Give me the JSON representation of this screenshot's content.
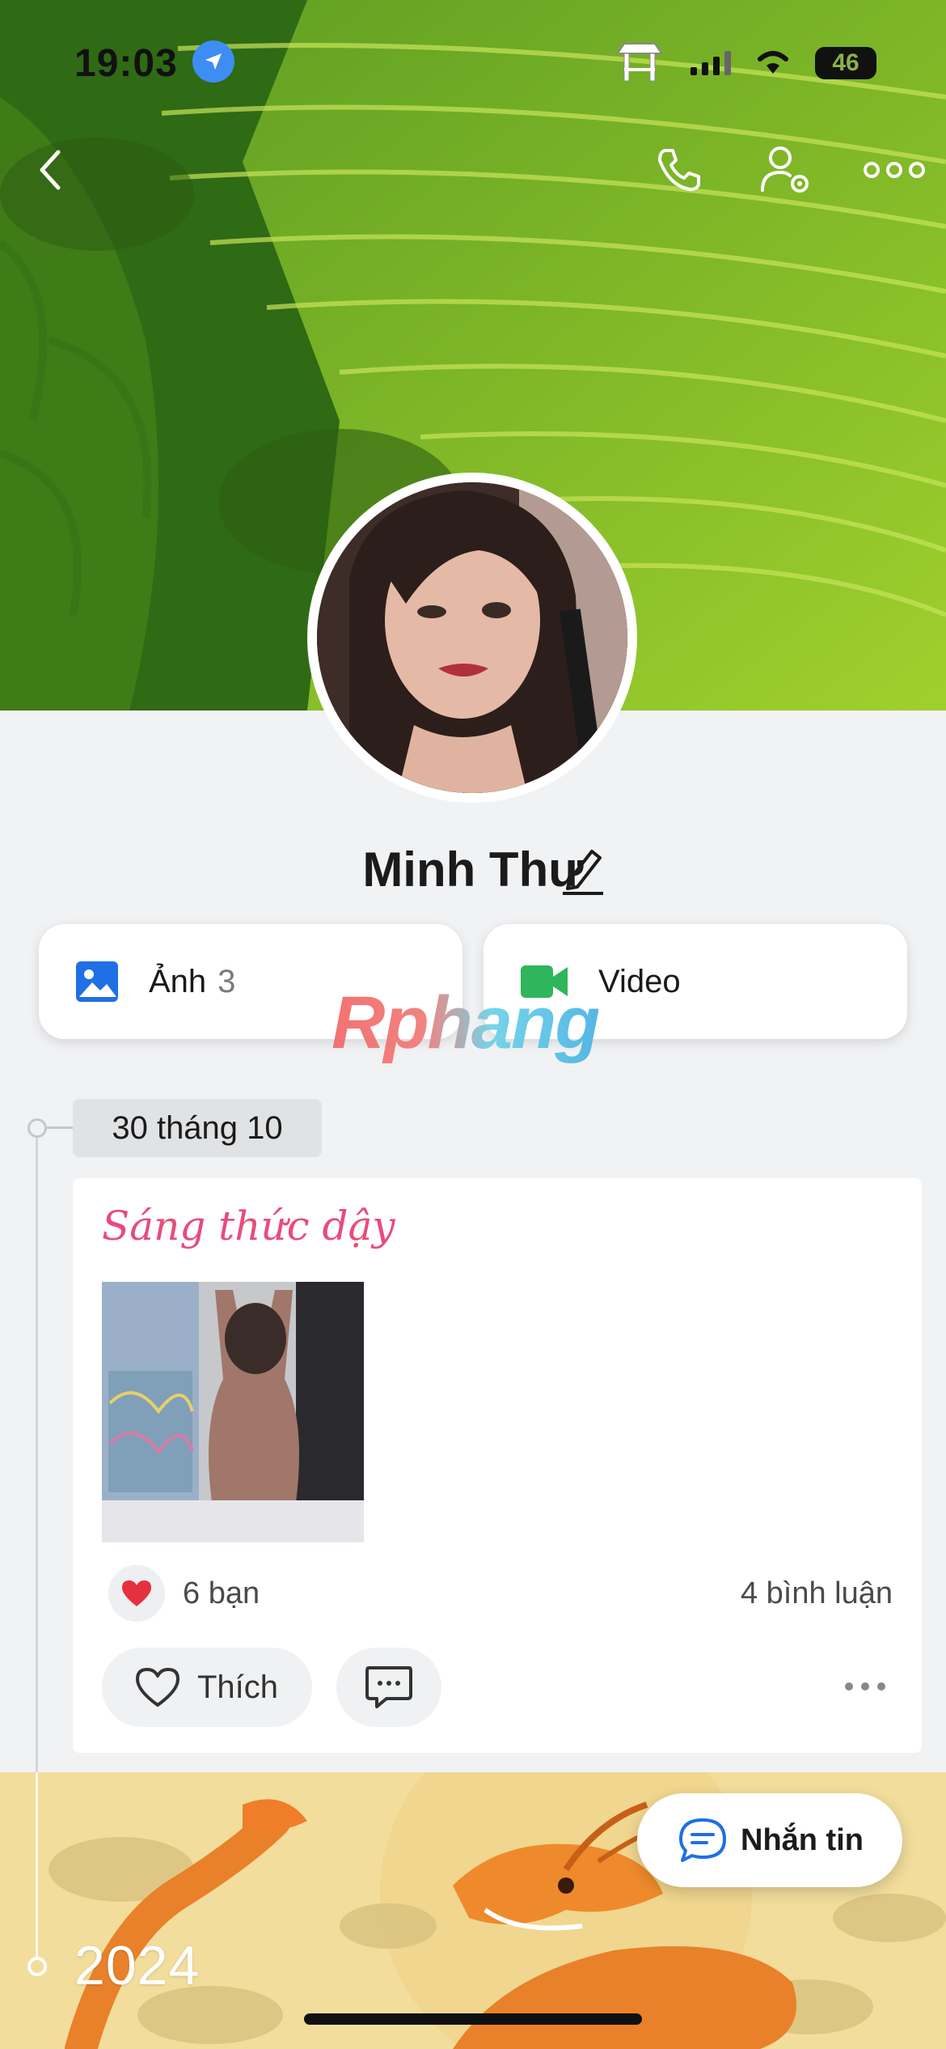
{
  "status_bar": {
    "time": "19:03",
    "battery": "46"
  },
  "header": {
    "back_icon": "chevron-left-icon",
    "call_icon": "phone-icon",
    "settings_icon": "user-settings-icon",
    "more_icon": "more-horizontal-icon"
  },
  "profile": {
    "name": "Minh Thư"
  },
  "media": {
    "photos_label": "Ảnh",
    "photos_count": "3",
    "video_label": "Video"
  },
  "watermark": "Rphang",
  "timeline": {
    "date": "30 tháng 10",
    "year": "2024"
  },
  "post": {
    "caption": "Sáng thức dậy",
    "reactions_count": "6 bạn",
    "comments_count": "4 bình luận",
    "like_label": "Thích"
  },
  "fab": {
    "label": "Nhắn tin"
  },
  "colors": {
    "caption": "#e94b7b",
    "photo_icon": "#1f6fe5",
    "video_icon": "#2fb55b",
    "message_icon": "#1f6fe5",
    "heart": "#e53040"
  }
}
